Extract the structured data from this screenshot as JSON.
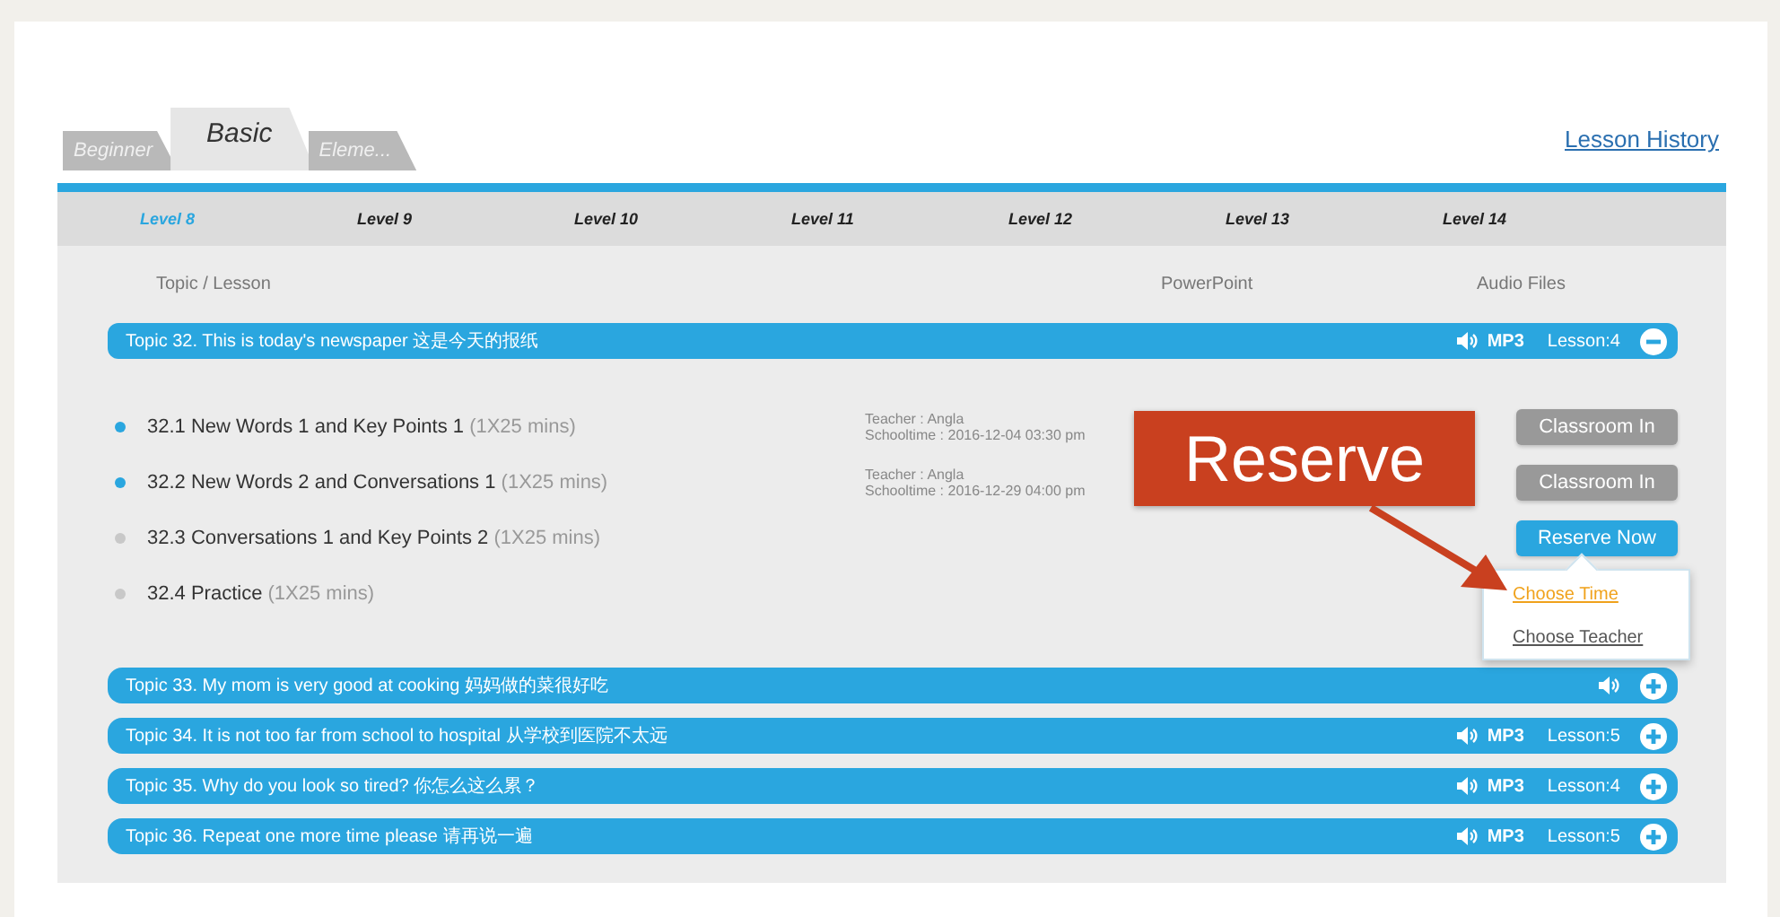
{
  "tabs": [
    {
      "label": "Beginner",
      "selected": false
    },
    {
      "label": "Basic",
      "selected": true
    },
    {
      "label": "Eleme...",
      "selected": false
    }
  ],
  "lesson_history_link": "Lesson History",
  "levels": [
    {
      "label": "Level 8",
      "selected": true
    },
    {
      "label": "Level 9",
      "selected": false
    },
    {
      "label": "Level 10",
      "selected": false
    },
    {
      "label": "Level 11",
      "selected": false
    },
    {
      "label": "Level 12",
      "selected": false
    },
    {
      "label": "Level 13",
      "selected": false
    },
    {
      "label": "Level 14",
      "selected": false
    }
  ],
  "columns": [
    "Topic / Lesson",
    "PowerPoint",
    "Audio Files"
  ],
  "topics": [
    {
      "title": "Topic 32. This is today's newspaper 这是今天的报纸",
      "mp3": "MP3",
      "lessons_count": "Lesson:4",
      "expanded": true,
      "lessons": [
        {
          "title": "32.1 New Words 1 and Key Points 1",
          "duration": "(1X25 mins)",
          "booked": true,
          "teacher": "Teacher : Angla",
          "schooltime": "Schooltime : 2016-12-04 03:30 pm",
          "action": {
            "kind": "classroom",
            "label": "Classroom In"
          }
        },
        {
          "title": "32.2 New Words 2 and Conversations 1",
          "duration": "(1X25 mins)",
          "booked": true,
          "teacher": "Teacher : Angla",
          "schooltime": "Schooltime : 2016-12-29 04:00 pm",
          "action": {
            "kind": "classroom",
            "label": "Classroom In"
          }
        },
        {
          "title": "32.3 Conversations 1 and Key Points 2",
          "duration": "(1X25 mins)",
          "booked": false,
          "action": {
            "kind": "reserve",
            "label": "Reserve Now"
          }
        },
        {
          "title": "32.4 Practice",
          "duration": "(1X25 mins)",
          "booked": false
        }
      ]
    },
    {
      "title": "Topic 33. My mom is very good at cooking 妈妈做的菜很好吃",
      "expanded": false
    },
    {
      "title": "Topic 34. It is not too far from school to hospital 从学校到医院不太远",
      "mp3": "MP3",
      "lessons_count": "Lesson:5",
      "expanded": false
    },
    {
      "title": "Topic 35. Why do you look so tired? 你怎么这么累？",
      "mp3": "MP3",
      "lessons_count": "Lesson:4",
      "expanded": false
    },
    {
      "title": "Topic 36. Repeat one more time please 请再说一遍",
      "mp3": "MP3",
      "lessons_count": "Lesson:5",
      "expanded": false
    }
  ],
  "reserve_menu": [
    {
      "label": "Choose Time",
      "selected": true
    },
    {
      "label": "Choose Teacher",
      "selected": false
    }
  ],
  "annotation": {
    "text": "Reserve"
  }
}
